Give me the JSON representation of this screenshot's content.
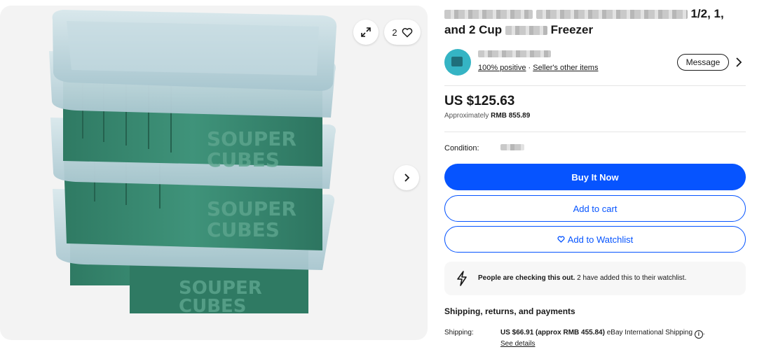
{
  "gallery": {
    "watch_count": "2",
    "product_logo_line1": "SOUPER",
    "product_logo_line2": "CUBES"
  },
  "listing": {
    "title_visible_1": "1/2, 1,",
    "title_visible_2": "and 2 Cup",
    "title_visible_3": "Freezer"
  },
  "seller": {
    "positive": "100% positive",
    "separator": " · ",
    "other_items": "Seller's other items",
    "message_label": "Message"
  },
  "price": {
    "main": "US $125.63",
    "approx_prefix": "Approximately ",
    "approx_value": "RMB 855.89"
  },
  "condition": {
    "label": "Condition:"
  },
  "actions": {
    "buy_now": "Buy It Now",
    "add_to_cart": "Add to cart",
    "add_to_watchlist": "Add to Watchlist"
  },
  "notice": {
    "bold": "People are checking this out.",
    "rest": " 2 have added this to their watchlist."
  },
  "shipping": {
    "heading": "Shipping, returns, and payments",
    "label": "Shipping:",
    "cost": "US $66.91 (approx RMB 455.84)",
    "method": " eBay International Shipping ",
    "after_icon": ".",
    "see_details": "See details"
  },
  "colors": {
    "accent_blue": "#0654ff",
    "tray_green": "#3a8a72",
    "lid": "#b8d3da"
  }
}
